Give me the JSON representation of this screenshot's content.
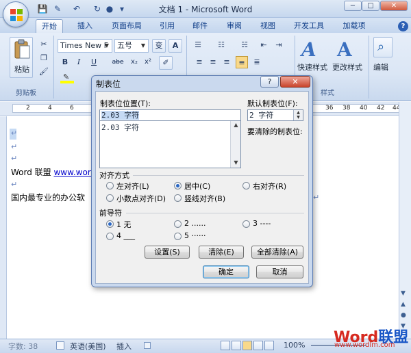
{
  "window": {
    "title": "文档 1 - Microsoft Word",
    "min": "−",
    "max": "□",
    "close": "✕"
  },
  "ribbon": {
    "tabs": [
      "开始",
      "插入",
      "页面布局",
      "引用",
      "邮件",
      "审阅",
      "视图",
      "开发工具",
      "加载项"
    ],
    "help": "?",
    "clipboard": {
      "paste_label": "粘贴",
      "group_label": "剪贴板"
    },
    "font": {
      "name": "Times New F",
      "size": "五号",
      "wen": "变",
      "a_box": "A"
    },
    "font_buttons": [
      "B",
      "I",
      "U",
      "abe",
      "x₂",
      "x²"
    ],
    "styles": {
      "quick": "快速样式",
      "change": "更改样式",
      "group_label": "样式"
    },
    "editing": {
      "label": "编辑"
    }
  },
  "ruler": {
    "numbers": [
      "2",
      "4",
      "6",
      "36",
      "38",
      "40",
      "42",
      "44"
    ]
  },
  "document": {
    "lines": [
      {
        "text": "",
        "selected": true
      },
      {
        "text": ""
      },
      {
        "text": ""
      },
      {
        "text": "Word 联盟  ",
        "link": "www.word"
      },
      {
        "text": ""
      },
      {
        "text": "国内最专业的办公软"
      }
    ],
    "para_mark": "↵"
  },
  "dialog": {
    "title": "制表位",
    "help": "?",
    "close": "✕",
    "tab_position_label": "制表位位置(T):",
    "tab_position_value": "2.03 字符",
    "tab_list": [
      "2.03 字符"
    ],
    "default_label": "默认制表位(F):",
    "default_value": "2 字符",
    "clear_label": "要清除的制表位:",
    "alignment_label": "对齐方式",
    "alignment_options": [
      {
        "label": "左对齐(L)",
        "checked": false
      },
      {
        "label": "居中(C)",
        "checked": true
      },
      {
        "label": "右对齐(R)",
        "checked": false
      },
      {
        "label": "小数点对齐(D)",
        "checked": false
      },
      {
        "label": "竖线对齐(B)",
        "checked": false
      }
    ],
    "leader_label": "前导符",
    "leader_options": [
      {
        "label": "1 无",
        "checked": true
      },
      {
        "label": "2 ......",
        "checked": false
      },
      {
        "label": "3 ----",
        "checked": false
      },
      {
        "label": "4 ___",
        "checked": false
      },
      {
        "label": "5 ······",
        "checked": false
      }
    ],
    "buttons": {
      "set": "设置(S)",
      "clear": "清除(E)",
      "clear_all": "全部清除(A)",
      "ok": "确定",
      "cancel": "取消"
    }
  },
  "status": {
    "word_count": "字数: 38",
    "language": "英语(美国)",
    "mode": "插入",
    "zoom": "100%"
  },
  "watermark": {
    "brand_red": "Word",
    "brand_blue": "联盟",
    "url": "www.wordlm.com"
  },
  "colors": {
    "ribbon_blue": "#dbe6f5",
    "dialog_frame": "#cad9ee",
    "accent": "#2a67c4",
    "watermark_red": "#d62a20"
  }
}
